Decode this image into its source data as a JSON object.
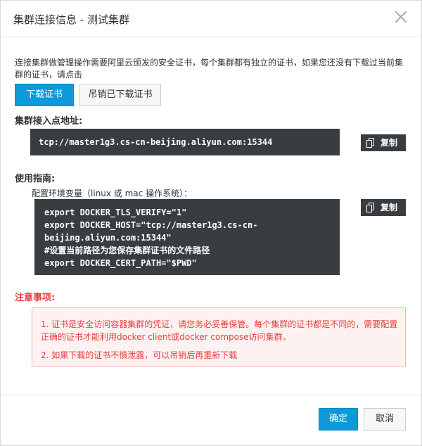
{
  "dialog": {
    "title": "集群连接信息 - 测试集群",
    "close_icon": "close-icon"
  },
  "intro": {
    "text": "连接集群做管理操作需要阿里云颁发的安全证书，每个集群都有独立的证书，如果您还没有下载过当前集群的证书，请点击"
  },
  "cert_actions": {
    "download_label": "下载证书",
    "revoke_label": "吊销已下载证书"
  },
  "endpoint": {
    "label": "集群接入点地址:",
    "value": "tcp://master1g3.cs-cn-beijing.aliyun.com:15344",
    "copy_label": "复制",
    "copy_icon": "copy-icon"
  },
  "guide": {
    "label": "使用指南:",
    "subtitle": "配置环境变量（linux 或 mac 操作系统）：",
    "lines": [
      "export DOCKER_TLS_VERIFY=\"1\"",
      "export DOCKER_HOST=\"tcp://master1g3.cs-cn-",
      "beijing.aliyun.com:15344\"",
      "#设置当前路径为您保存集群证书的文件路径",
      "export DOCKER_CERT_PATH=\"$PWD\""
    ],
    "copy_label": "复制",
    "copy_icon": "copy-icon"
  },
  "notes": {
    "label": "注意事项:",
    "items": [
      "1. 证书是安全访问容器集群的凭证，请您务必妥善保管。每个集群的证书都是不同的，需要配置正确的证书才能利用docker client或docker compose访问集群。",
      "2. 如果下载的证书不慎泄露，可以吊销后再重新下载"
    ]
  },
  "footer": {
    "ok_label": "确定",
    "cancel_label": "取消"
  },
  "colors": {
    "primary": "#0d9ad9",
    "code_bg": "#373d41",
    "warning": "#e73d3d",
    "warning_bg": "#fdf2f1"
  }
}
